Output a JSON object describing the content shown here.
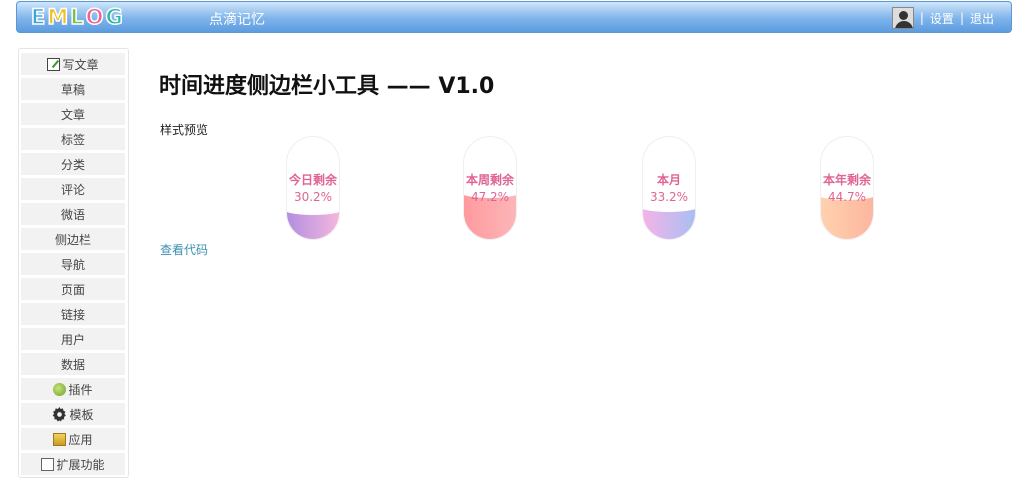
{
  "header": {
    "logo_letters": [
      "E",
      "M",
      "L",
      "O",
      "G"
    ],
    "logo_colors": [
      "#3aa7d8",
      "#f4c020",
      "#7bc043",
      "#f06292",
      "#2bb6a8"
    ],
    "site_name": "点滴记忆",
    "separator": "|",
    "settings_label": "设置",
    "logout_label": "退出",
    "avatar_icon": "user-avatar-icon"
  },
  "sidebar": {
    "items": [
      {
        "label": "写文章",
        "icon": "pen-icon"
      },
      {
        "label": "草稿"
      },
      {
        "label": "文章"
      },
      {
        "label": "标签"
      },
      {
        "label": "分类"
      },
      {
        "label": "评论"
      },
      {
        "label": "微语"
      },
      {
        "label": "侧边栏"
      },
      {
        "label": "导航"
      },
      {
        "label": "页面"
      },
      {
        "label": "链接"
      },
      {
        "label": "用户"
      },
      {
        "label": "数据"
      },
      {
        "label": "插件",
        "icon": "plugin-icon"
      },
      {
        "label": "模板",
        "icon": "gear-icon"
      },
      {
        "label": "应用",
        "icon": "app-icon"
      },
      {
        "label": "扩展功能",
        "icon": "ext-icon"
      }
    ]
  },
  "main": {
    "title": "时间进度侧边栏小工具 —— V1.0",
    "preview_label": "样式预览",
    "view_code_label": "查看代码",
    "widgets": [
      {
        "label": "今日剩余",
        "value": "30.2%",
        "progress": 0.302,
        "colors": [
          "#b38fe0",
          "#f3b7dc"
        ]
      },
      {
        "label": "本周剩余",
        "value": "47.2%",
        "progress": 0.472,
        "colors": [
          "#ff9a9e",
          "#fcb6b8"
        ]
      },
      {
        "label": "本月",
        "value": "33.2%",
        "progress": 0.332,
        "colors": [
          "#f5b3e8",
          "#a9bff2"
        ]
      },
      {
        "label": "本年剩余",
        "value": "44.7%",
        "progress": 0.447,
        "colors": [
          "#ffd2ae",
          "#fcb69f"
        ]
      }
    ]
  }
}
